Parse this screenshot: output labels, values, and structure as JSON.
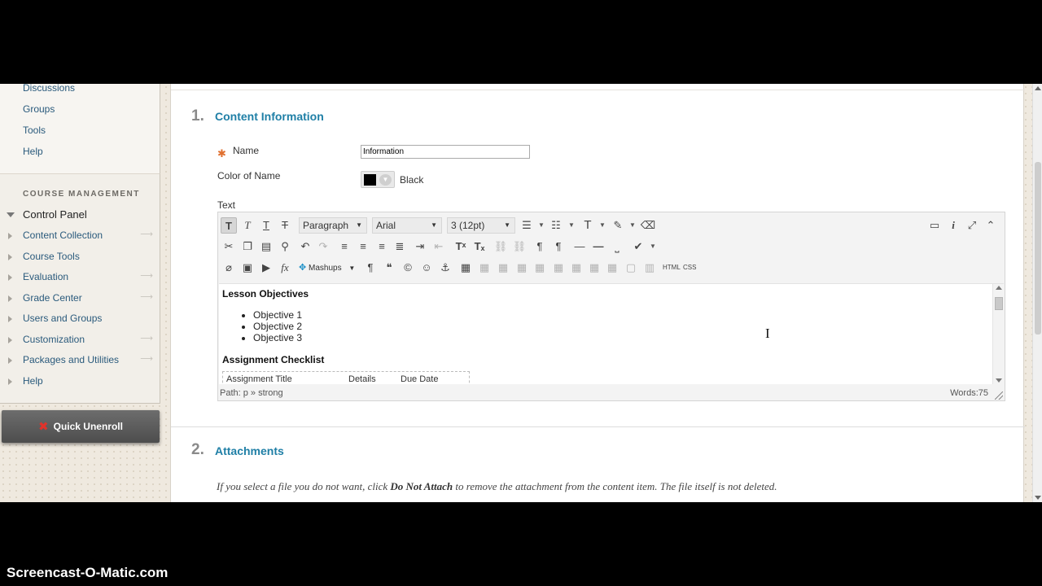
{
  "sidebar": {
    "top_links": [
      "Discussions",
      "Groups",
      "Tools",
      "Help"
    ],
    "section_title": "COURSE MANAGEMENT",
    "control_panel": "Control Panel",
    "items": [
      "Content Collection",
      "Course Tools",
      "Evaluation",
      "Grade Center",
      "Users and Groups",
      "Customization",
      "Packages and Utilities",
      "Help"
    ],
    "quick_unenroll": "Quick Unenroll"
  },
  "content_info": {
    "step": "1.",
    "title": "Content Information",
    "name_label": "Name",
    "name_value": "Information",
    "color_label": "Color of Name",
    "color_value": "Black",
    "text_label": "Text"
  },
  "editor": {
    "paragraph": "Paragraph",
    "font": "Arial",
    "size": "3 (12pt)",
    "mashups": "Mashups",
    "html_btn": "HTML",
    "css_btn": "CSS",
    "lesson_heading": "Lesson Objectives",
    "objectives": [
      "Objective 1",
      "Objective 2",
      "Objective 3"
    ],
    "assignment_heading": "Assignment Checklist",
    "table_headers": [
      "Assignment Title",
      "Details",
      "Due Date"
    ],
    "path": "Path: p » strong",
    "word_count": "Words:75"
  },
  "attachments": {
    "step": "2.",
    "title": "Attachments",
    "note_before": "If you select a file you do not want, click",
    "note_bold": "Do Not Attach",
    "note_after": "to remove the attachment from the content item. The file itself is not deleted."
  },
  "watermark": "Screencast-O-Matic.com"
}
